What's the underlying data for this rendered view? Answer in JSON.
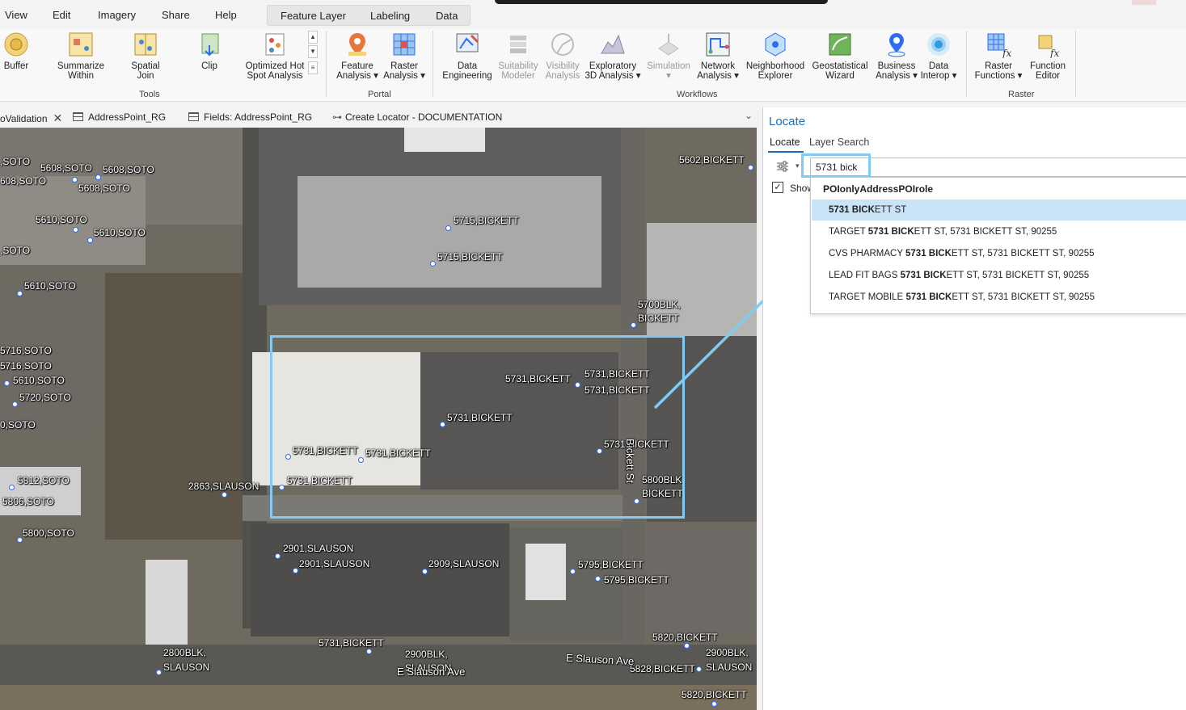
{
  "menu": {
    "items": [
      "View",
      "Edit",
      "Imagery",
      "Share",
      "Help"
    ],
    "contextual_tabs": [
      "Feature Layer",
      "Labeling",
      "Data"
    ]
  },
  "ribbon": {
    "tools_group": {
      "label": "Tools",
      "buttons": [
        {
          "l1": "Buffer",
          "l2": ""
        },
        {
          "l1": "Summarize",
          "l2": "Within"
        },
        {
          "l1": "Spatial",
          "l2": "Join"
        },
        {
          "l1": "Clip",
          "l2": ""
        },
        {
          "l1": "Optimized Hot",
          "l2": "Spot Analysis"
        }
      ]
    },
    "portal_group": {
      "label": "Portal",
      "buttons": [
        {
          "l1": "Feature",
          "l2": "Analysis"
        },
        {
          "l1": "Raster",
          "l2": "Analysis"
        }
      ]
    },
    "workflows_group": {
      "label": "Workflows",
      "buttons": [
        {
          "l1": "Data",
          "l2": "Engineering"
        },
        {
          "l1": "Suitability",
          "l2": "Modeler"
        },
        {
          "l1": "Visibility",
          "l2": "Analysis"
        },
        {
          "l1": "Exploratory",
          "l2": "3D Analysis"
        },
        {
          "l1": "Simulation",
          "l2": ""
        },
        {
          "l1": "Network",
          "l2": "Analysis"
        },
        {
          "l1": "Neighborhood",
          "l2": "Explorer"
        },
        {
          "l1": "Geostatistical",
          "l2": "Wizard"
        },
        {
          "l1": "Business",
          "l2": "Analysis"
        },
        {
          "l1": "Data",
          "l2": "Interop"
        }
      ]
    },
    "raster_group": {
      "label": "Raster",
      "buttons": [
        {
          "l1": "Raster",
          "l2": "Functions"
        },
        {
          "l1": "Function",
          "l2": "Editor"
        }
      ]
    }
  },
  "tabs": [
    {
      "label": "oValidation"
    },
    {
      "label": "AddressPoint_RG"
    },
    {
      "label": "Fields: AddressPoint_RG"
    },
    {
      "label": "Create Locator - DOCUMENTATION"
    }
  ],
  "map": {
    "labels": [
      "5608,SOTO",
      "5608,SOTO",
      "608,SOTO",
      "5608,SOTO",
      ",SOTO",
      "5610,SOTO",
      "5610,SOTO",
      ",SOTO",
      "5610,SOTO",
      "5716,SOTO",
      "5716,SOTO",
      "5610,SOTO",
      "5720,SOTO",
      "0,SOTO",
      "5812,SOTO",
      "5806,SOTO",
      "5800,SOTO",
      "5715,BICKETT",
      "5715,BICKETT",
      "5602,BICKETT",
      "5700BLK,",
      "BICKETT",
      "5731,BICKETT",
      "5731,BICKETT",
      "5731,BICKETT",
      "5731,BICKETT",
      "5731,BICKETT",
      "5731,BICKETT",
      "5731,BICKETT",
      "5731,BICKETT",
      "5800BLK",
      "BICKETT",
      "2863,SLAUSON",
      "2901,SLAUSON",
      "2901,SLAUSON",
      "2909,SLAUSON",
      "5795,BICKETT",
      "5795,BICKETT",
      "5731,BICKETT",
      "2800BLK,",
      "SLAUSON",
      "2900BLK,",
      "SLAUSON",
      "5820,BICKETT",
      "2900BLK,",
      "SLAUSON",
      "5828,BICKETT",
      "5820,BICKETT",
      "E Slauson Ave",
      "E Slauson Ave",
      "Bickett St"
    ]
  },
  "locate": {
    "title": "Locate",
    "tabs": [
      "Locate",
      "Layer Search"
    ],
    "search_value": "5731 bick",
    "show_label": "Show",
    "group_header": "POIonlyAddressPOIrole",
    "suggestions": [
      {
        "pre": "",
        "bold": "5731 BICK",
        "post": "ETT ST"
      },
      {
        "pre": "TARGET ",
        "bold": "5731 BICK",
        "post": "ETT ST, 5731 BICKETT ST, 90255"
      },
      {
        "pre": "CVS PHARMACY ",
        "bold": "5731 BICK",
        "post": "ETT ST, 5731 BICKETT ST, 90255"
      },
      {
        "pre": "LEAD FIT BAGS ",
        "bold": "5731 BICK",
        "post": "ETT ST, 5731 BICKETT ST, 90255"
      },
      {
        "pre": "TARGET MOBILE ",
        "bold": "5731 BICK",
        "post": "ETT ST, 5731 BICKETT ST, 90255"
      }
    ]
  },
  "colors": {
    "accent": "#1a6fb5",
    "highlight_box": "#7fcbf2",
    "selected_row": "#c9e3f7",
    "address_point": "#2e6cf6"
  }
}
